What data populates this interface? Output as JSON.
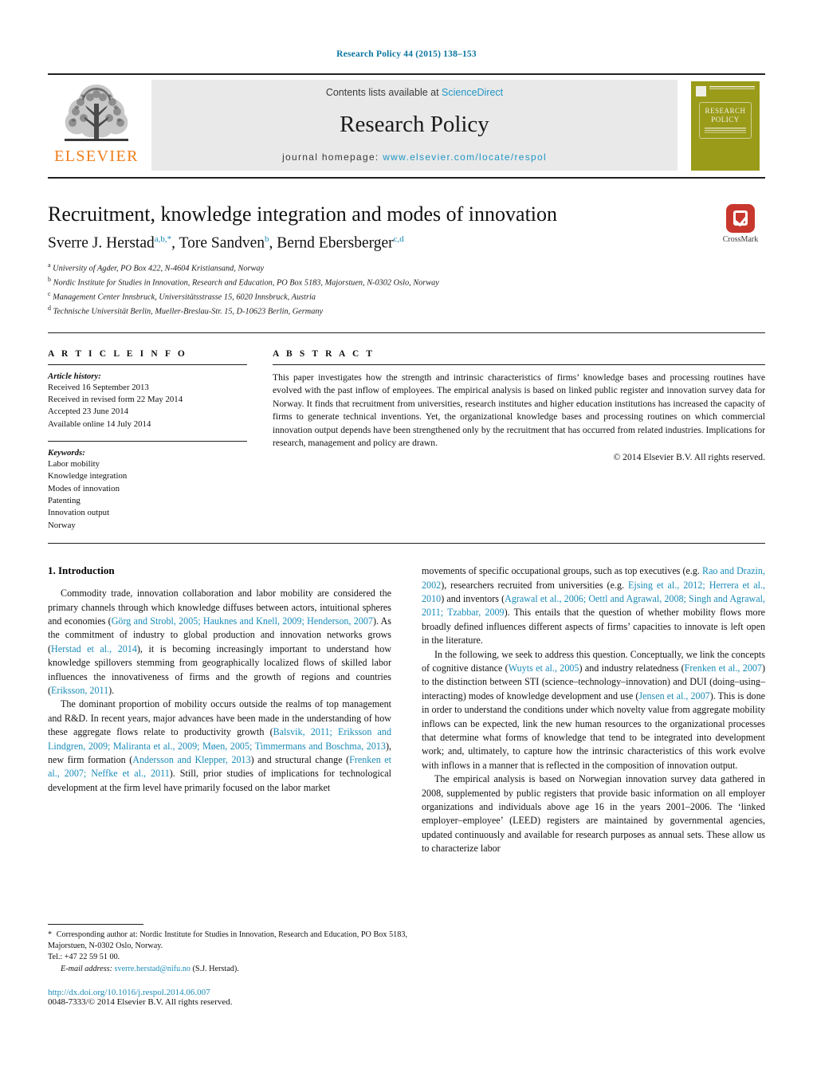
{
  "running_head": "Research Policy 44 (2015) 138–153",
  "masthead": {
    "publisher_name": "ELSEVIER",
    "contents_prefix": "Contents lists available at ",
    "sciencedirect": "ScienceDirect",
    "journal_name": "Research Policy",
    "homepage_prefix": "journal homepage: ",
    "homepage_url": "www.elsevier.com/locate/respol",
    "cover_title_line1": "RESEARCH",
    "cover_title_line2": "POLICY",
    "accent_link_color": "#2196c4",
    "elsevier_orange": "#ef7d1a",
    "cover_color": "#9a9b19"
  },
  "title_block": {
    "title": "Recruitment, knowledge integration and modes of innovation",
    "authors": [
      {
        "name": "Sverre J. Herstad",
        "marks": "a,b,*"
      },
      {
        "name": "Tore Sandven",
        "marks": "b"
      },
      {
        "name": "Bernd Ebersberger",
        "marks": "c,d"
      }
    ],
    "affiliations": [
      {
        "mark": "a",
        "text": "University of Agder, PO Box 422, N-4604 Kristiansand, Norway"
      },
      {
        "mark": "b",
        "text": "Nordic Institute for Studies in Innovation, Research and Education, PO Box 5183, Majorstuen, N-0302 Oslo, Norway"
      },
      {
        "mark": "c",
        "text": "Management Center Innsbruck, Universitätsstrasse 15, 6020 Innsbruck, Austria"
      },
      {
        "mark": "d",
        "text": "Technische Universität Berlin, Mueller-Breslau-Str. 15, D-10623 Berlin, Germany"
      }
    ],
    "crossmark_label": "CrossMark",
    "crossmark_color": "#c8372d"
  },
  "article_info": {
    "heading": "A R T I C L E    I N F O",
    "history_label": "Article history:",
    "history": [
      "Received 16 September 2013",
      "Received in revised form 22 May 2014",
      "Accepted 23 June 2014",
      "Available online 14 July 2014"
    ],
    "keywords_label": "Keywords:",
    "keywords": [
      "Labor mobility",
      "Knowledge integration",
      "Modes of innovation",
      "Patenting",
      "Innovation output",
      "Norway"
    ]
  },
  "abstract": {
    "heading": "A B S T R A C T",
    "text": "This paper investigates how the strength and intrinsic characteristics of firms’ knowledge bases and processing routines have evolved with the past inflow of employees. The empirical analysis is based on linked public register and innovation survey data for Norway. It finds that recruitment from universities, research institutes and higher education institutions has increased the capacity of firms to generate technical inventions. Yet, the organizational knowledge bases and processing routines on which commercial innovation output depends have been strengthened only by the recruitment that has occurred from related industries. Implications for research, management and policy are drawn.",
    "copyright": "© 2014 Elsevier B.V. All rights reserved."
  },
  "body": {
    "section_number_title": "1.  Introduction",
    "left_paragraph_1_a": "Commodity trade, innovation collaboration and labor mobility are considered the primary channels through which knowledge diffuses between actors, intuitional spheres and economies (",
    "left_paragraph_1_cite1": "Görg and Strobl, 2005; Hauknes and Knell, 2009; Henderson, 2007",
    "left_paragraph_1_b": "). As the commitment of industry to global production and innovation networks grows (",
    "left_paragraph_1_cite2": "Herstad et al., 2014",
    "left_paragraph_1_c": "), it is becoming increasingly important to understand how knowledge spillovers stemming from geographically localized flows of skilled labor influences the innovativeness of firms and the growth of regions and countries (",
    "left_paragraph_1_cite3": "Eriksson, 2011",
    "left_paragraph_1_d": ").",
    "left_paragraph_2_a": "The dominant proportion of mobility occurs outside the realms of top management and R&D. In recent years, major advances have been made in the understanding of how these aggregate flows relate to productivity growth (",
    "left_paragraph_2_cite1": "Balsvik, 2011; Eriksson and Lindgren, 2009; Maliranta et al., 2009; Møen, 2005; Timmermans and Boschma, 2013",
    "left_paragraph_2_b": "), new firm formation (",
    "left_paragraph_2_cite2": "Andersson and Klepper, 2013",
    "left_paragraph_2_c": ") and structural change (",
    "left_paragraph_2_cite3": "Frenken et al., 2007; Neffke et al., 2011",
    "left_paragraph_2_d": "). Still, prior studies of implications for technological development at the firm level have primarily focused on the labor market",
    "right_paragraph_1_a": "movements of specific occupational groups, such as top executives (e.g. ",
    "right_paragraph_1_cite1": "Rao and Drazin, 2002",
    "right_paragraph_1_b": "), researchers recruited from universities (e.g. ",
    "right_paragraph_1_cite2": "Ejsing et al., 2012; Herrera et al., 2010",
    "right_paragraph_1_c": ") and inventors (",
    "right_paragraph_1_cite3": "Agrawal et al., 2006; Oettl and Agrawal, 2008; Singh and Agrawal, 2011; Tzabbar, 2009",
    "right_paragraph_1_d": "). This entails that the question of whether mobility flows more broadly defined influences different aspects of firms’ capacities to innovate is left open in the literature.",
    "right_paragraph_2_a": "In the following, we seek to address this question. Conceptually, we link the concepts of cognitive distance (",
    "right_paragraph_2_cite1": "Wuyts et al., 2005",
    "right_paragraph_2_b": ") and industry relatedness (",
    "right_paragraph_2_cite2": "Frenken et al., 2007",
    "right_paragraph_2_c": ") to the distinction between STI (science–technology–innovation) and DUI (doing–using–interacting) modes of knowledge development and use (",
    "right_paragraph_2_cite3": "Jensen et al., 2007",
    "right_paragraph_2_d": "). This is done in order to understand the conditions under which novelty value from aggregate mobility inflows can be expected, link the new human resources to the organizational processes that determine what forms of knowledge that tend to be integrated into development work; and, ultimately, to capture how the intrinsic characteristics of this work evolve with inflows in a manner that is reflected in the composition of innovation output.",
    "right_paragraph_3": "The empirical analysis is based on Norwegian innovation survey data gathered in 2008, supplemented by public registers that provide basic information on all employer organizations and individuals above age 16 in the years 2001–2006. The ‘linked employer–employee’ (LEED) registers are maintained by governmental agencies, updated continuously and available for research purposes as annual sets. These allow us to characterize labor",
    "citation_color": "#1a8cba"
  },
  "footnote": {
    "star": "*",
    "corresponding_text": "Corresponding author at: Nordic Institute for Studies in Innovation, Research and Education, PO Box 5183, Majorstuen, N-0302 Oslo, Norway.",
    "tel": "Tel.: +47 22 59 51 00.",
    "email_label": "E-mail address:",
    "email": "sverre.herstad@nifu.no",
    "email_suffix": "(S.J. Herstad).",
    "doi": "http://dx.doi.org/10.1016/j.respol.2014.06.007",
    "issn": "0048-7333/© 2014 Elsevier B.V. All rights reserved."
  }
}
